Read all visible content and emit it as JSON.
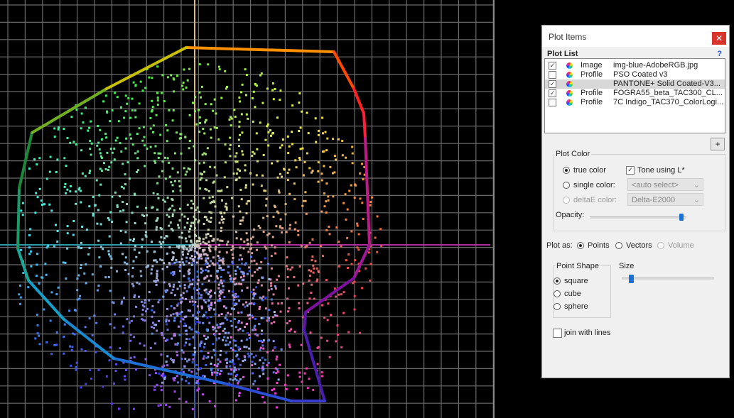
{
  "panel": {
    "title": "Plot Items",
    "close_glyph": "✕",
    "plot_list_label": "Plot List",
    "help_glyph": "?",
    "add_glyph": "+",
    "items": [
      {
        "checked": true,
        "kind": "Image",
        "name": "img-blue-AdobeRGB.jpg"
      },
      {
        "checked": false,
        "kind": "Profile",
        "name": "PSO Coated v3"
      },
      {
        "checked": true,
        "kind": "",
        "name": "PANTONE+ Solid Coated-V3...",
        "selected": true
      },
      {
        "checked": true,
        "kind": "Profile",
        "name": "FOGRA55_beta_TAC300_CL..."
      },
      {
        "checked": false,
        "kind": "Profile",
        "name": "7C Indigo_TAC370_ColorLogi..."
      }
    ],
    "plot_color": {
      "group_label": "Plot Color",
      "true_color_label": "true color",
      "single_color_label": "single color:",
      "deltae_label": "deltaE color:",
      "tone_label": "Tone using L*",
      "single_select_value": "<auto select>",
      "deltae_select_value": "Delta-E2000",
      "opacity_label": "Opacity:",
      "opacity_value": 0.95
    },
    "plot_as": {
      "label": "Plot as:",
      "points_label": "Points",
      "vectors_label": "Vectors",
      "volume_label": "Volume"
    },
    "point_shape": {
      "group_label": "Point Shape",
      "square_label": "square",
      "cube_label": "cube",
      "sphere_label": "sphere"
    },
    "size": {
      "label": "Size",
      "value": 0.1
    },
    "join_label": "join with lines"
  },
  "colors": {
    "gamut_line": "#ff8800",
    "panel_bg": "#f0f0f0",
    "accent": "#1a72d8"
  }
}
